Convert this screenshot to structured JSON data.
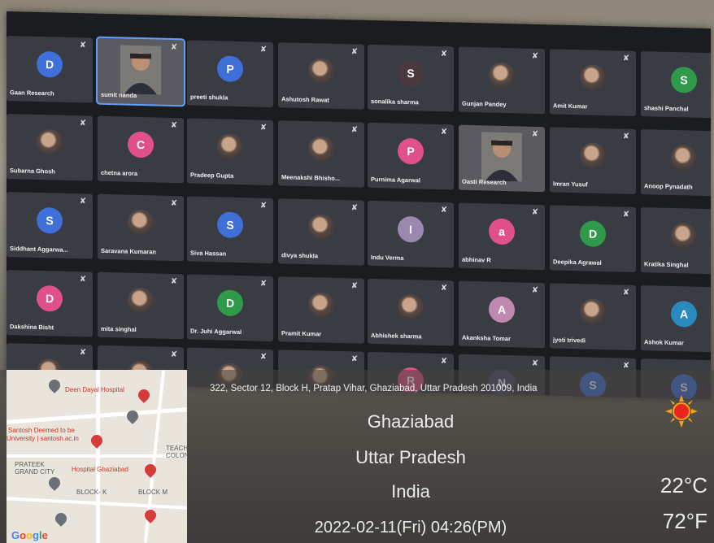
{
  "meeting": {
    "rows": [
      [
        {
          "name": "Gaan Research",
          "initial": "D",
          "color": "#3f6fd9",
          "type": "letter"
        },
        {
          "name": "sumit nanda",
          "initial": "",
          "color": "",
          "type": "video",
          "speaking": true
        },
        {
          "name": "preeti shukla",
          "initial": "P",
          "color": "#3f6fd9",
          "type": "letter"
        },
        {
          "name": "Ashutosh Rawat",
          "initial": "",
          "color": "",
          "type": "photo"
        },
        {
          "name": "sonalika sharma",
          "initial": "S",
          "color": "#4a3a3f",
          "type": "letter"
        },
        {
          "name": "Gunjan Pandey",
          "initial": "",
          "color": "",
          "type": "photo"
        },
        {
          "name": "Amit Kumar",
          "initial": "",
          "color": "",
          "type": "photo"
        },
        {
          "name": "shashi Panchal",
          "initial": "S",
          "color": "#2e9a4a",
          "type": "letter"
        }
      ],
      [
        {
          "name": "Subarna Ghosh",
          "initial": "",
          "color": "",
          "type": "photo"
        },
        {
          "name": "chetna arora",
          "initial": "C",
          "color": "#e0508a",
          "type": "letter"
        },
        {
          "name": "Pradeep Gupta",
          "initial": "",
          "color": "",
          "type": "photo"
        },
        {
          "name": "Meenakshi Bhisho...",
          "initial": "",
          "color": "",
          "type": "photo"
        },
        {
          "name": "Purnima Agarwal",
          "initial": "P",
          "color": "#e0508a",
          "type": "letter"
        },
        {
          "name": "Oasti Research",
          "initial": "",
          "color": "",
          "type": "video"
        },
        {
          "name": "Imran Yusuf",
          "initial": "",
          "color": "",
          "type": "photo"
        },
        {
          "name": "Anoop Pynadath",
          "initial": "",
          "color": "",
          "type": "photo"
        }
      ],
      [
        {
          "name": "Siddhant Aggarwa...",
          "initial": "S",
          "color": "#3f6fd9",
          "type": "letter"
        },
        {
          "name": "Saravana Kumaran",
          "initial": "",
          "color": "",
          "type": "photo"
        },
        {
          "name": "Siva Hassan",
          "initial": "S",
          "color": "#3f6fd9",
          "type": "letter"
        },
        {
          "name": "divya shukla",
          "initial": "",
          "color": "",
          "type": "photo"
        },
        {
          "name": "Indu Verma",
          "initial": "I",
          "color": "#9a88b0",
          "type": "letter"
        },
        {
          "name": "abhinav R",
          "initial": "a",
          "color": "#e0508a",
          "type": "letter"
        },
        {
          "name": "Deepika Agrawal",
          "initial": "D",
          "color": "#2e9a4a",
          "type": "letter"
        },
        {
          "name": "Kratika Singhal",
          "initial": "",
          "color": "",
          "type": "photo"
        }
      ],
      [
        {
          "name": "Dakshina Bisht",
          "initial": "D",
          "color": "#e0508a",
          "type": "letter"
        },
        {
          "name": "mita singhal",
          "initial": "",
          "color": "",
          "type": "photo"
        },
        {
          "name": "Dr. Juhi Aggarwal",
          "initial": "D",
          "color": "#2e9a4a",
          "type": "letter"
        },
        {
          "name": "Pramit Kumar",
          "initial": "",
          "color": "",
          "type": "photo"
        },
        {
          "name": "Abhishek sharma",
          "initial": "",
          "color": "",
          "type": "photo"
        },
        {
          "name": "Akanksha Tomar",
          "initial": "A",
          "color": "#c08ab0",
          "type": "letter"
        },
        {
          "name": "jyoti trivedi",
          "initial": "",
          "color": "",
          "type": "photo"
        },
        {
          "name": "Ashok Kumar",
          "initial": "A",
          "color": "#2a8ac0",
          "type": "letter"
        }
      ],
      [
        {
          "name": "",
          "initial": "",
          "color": "",
          "type": "photo"
        },
        {
          "name": "",
          "initial": "",
          "color": "",
          "type": "photo"
        },
        {
          "name": "",
          "initial": "",
          "color": "",
          "type": "photo"
        },
        {
          "name": "",
          "initial": "",
          "color": "",
          "type": "photo"
        },
        {
          "name": "",
          "initial": "R",
          "color": "#e0508a",
          "type": "letter"
        },
        {
          "name": "",
          "initial": "N",
          "color": "#4a4a70",
          "type": "letter"
        },
        {
          "name": "",
          "initial": "S",
          "color": "#3f6fd9",
          "type": "letter"
        },
        {
          "name": "",
          "initial": "S",
          "color": "#3f6fd9",
          "type": "letter"
        }
      ]
    ]
  },
  "map": {
    "labels": [
      {
        "text": "Deen Dayal Hospital",
        "cls": "red"
      },
      {
        "text": "Santosh Deemed to be",
        "cls": "red"
      },
      {
        "text": "University | santosh.ac.in",
        "cls": "red"
      },
      {
        "text": "PRATEEK GRAND CITY",
        "cls": ""
      },
      {
        "text": "Hospital Ghaziabad",
        "cls": "red"
      },
      {
        "text": "BLOCK- K",
        "cls": ""
      },
      {
        "text": "BLOCK M",
        "cls": ""
      },
      {
        "text": "TEACHERS COLONY",
        "cls": ""
      }
    ],
    "logo": "Google"
  },
  "stamp": {
    "address": "322, Sector 12, Block H, Pratap Vihar, Ghaziabad, Uttar Pradesh 201009, India",
    "city": "Ghaziabad",
    "state": "Uttar Pradesh",
    "country": "India",
    "datetime": "2022-02-11(Fri)  04:26(PM)",
    "temp_c": "22°C",
    "temp_f": "72°F"
  }
}
